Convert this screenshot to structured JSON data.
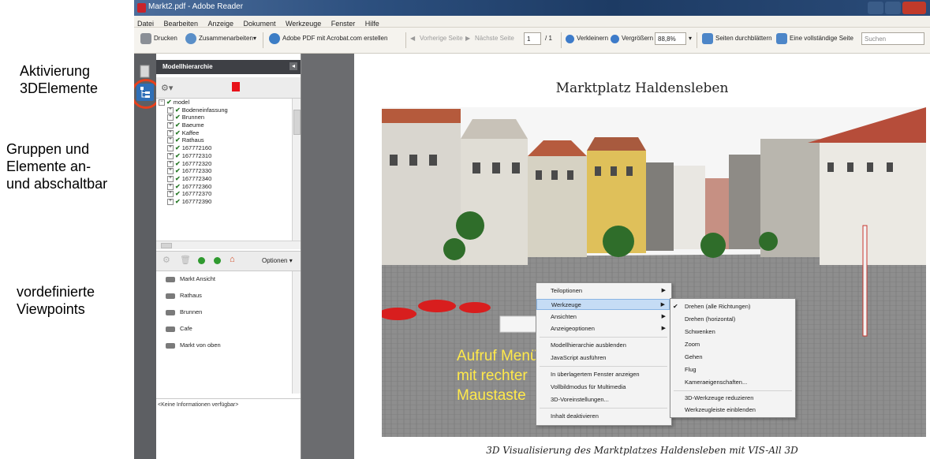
{
  "annotations": {
    "activation_line1": "Aktivierung",
    "activation_line2": "3DElemente",
    "groups_line1": "Gruppen und",
    "groups_line2": "Elemente an-",
    "groups_line3": "und abschaltbar",
    "viewpoints_line1": "vordefinierte",
    "viewpoints_line2": "Viewpoints",
    "menu_note_line1": "Aufruf Menü",
    "menu_note_line2": "mit rechter",
    "menu_note_line3": "Maustaste"
  },
  "window": {
    "title": "Markt2.pdf - Adobe Reader"
  },
  "menubar": [
    "Datei",
    "Bearbeiten",
    "Anzeige",
    "Dokument",
    "Werkzeuge",
    "Fenster",
    "Hilfe"
  ],
  "toolbar": {
    "print": "Drucken",
    "collaborate": "Zusammenarbeiten",
    "create_pdf": "Adobe PDF mit Acrobat.com erstellen",
    "prev_page": "Vorherige Seite",
    "next_page": "Nächste Seite",
    "page_current": "1",
    "page_total": "/ 1",
    "zoom_out": "Verkleinern",
    "zoom_in": "Vergrößern",
    "zoom_value": "88,8%",
    "scroll_pages": "Seiten durchblättern",
    "full_page": "Eine vollständige Seite",
    "search_placeholder": "Suchen"
  },
  "panel": {
    "title": "Modellhierarchie",
    "tree": [
      "model",
      "Bodeneinfassung",
      "Brunnen",
      "Baeume",
      "Kaffee",
      "Rathaus",
      "167772160",
      "167772310",
      "167772320",
      "167772330",
      "167772340",
      "167772360",
      "167772370",
      "167772390"
    ],
    "options_label": "Optionen",
    "viewpoints": [
      "Markt Ansicht",
      "Rathaus",
      "Brunnen",
      "Cafe",
      "Markt von oben"
    ],
    "info_text": "<Keine Informationen verfügbar>"
  },
  "document": {
    "title": "Marktplatz Haldensleben",
    "caption": "3D Visualisierung des Marktplatzes Haldensleben mit VIS-All 3D"
  },
  "context_menu": {
    "items": [
      {
        "label": "Teiloptionen",
        "submenu": true
      },
      {
        "label": "Werkzeuge",
        "submenu": true
      },
      {
        "label": "Ansichten",
        "submenu": true
      },
      {
        "label": "Anzeigeoptionen",
        "submenu": true
      },
      {
        "label": "Modellhierarchie ausblenden",
        "submenu": false
      },
      {
        "label": "JavaScript ausführen",
        "submenu": false
      },
      {
        "label": "In überlagertem Fenster anzeigen",
        "submenu": false
      },
      {
        "label": "Vollbildmodus für Multimedia",
        "submenu": false
      },
      {
        "label": "3D-Voreinstellungen...",
        "submenu": false
      },
      {
        "label": "Inhalt deaktivieren",
        "submenu": false
      }
    ],
    "submenu": [
      "Drehen (alle Richtungen)",
      "Drehen (horizontal)",
      "Schwenken",
      "Zoom",
      "Gehen",
      "Flug",
      "Kameraeigenschaften...",
      "3D-Werkzeuge reduzieren",
      "Werkzeugleiste einblenden"
    ]
  },
  "colors": {
    "accent_ring": "#e8401c",
    "menu_highlight": "#c5dcf5",
    "yellow_note": "#ffe94a"
  }
}
